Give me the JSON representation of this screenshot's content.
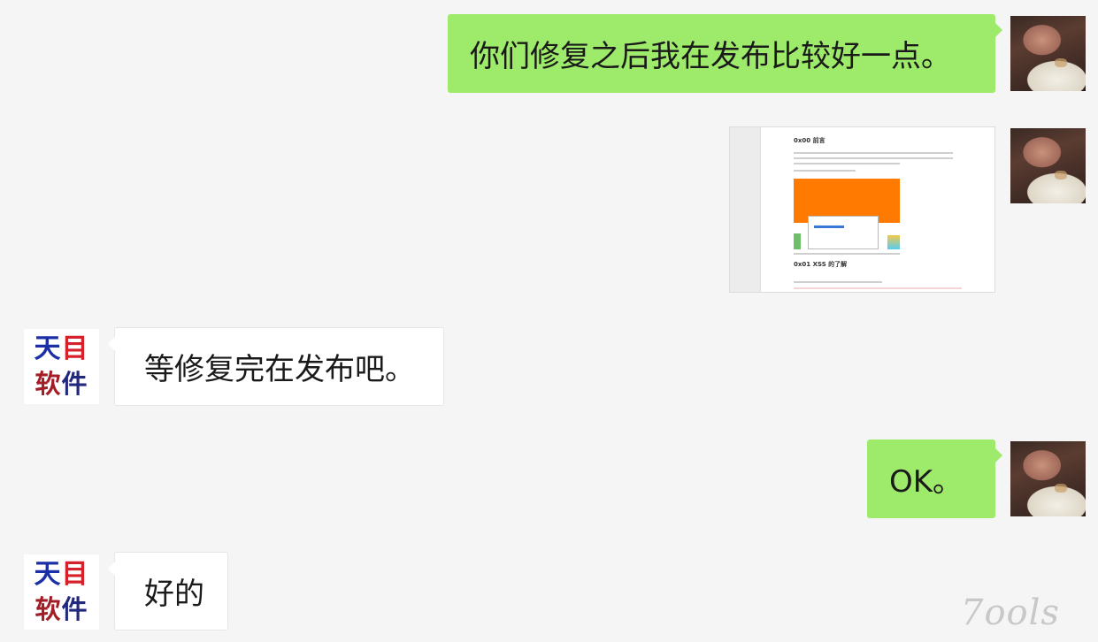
{
  "messages": [
    {
      "sender": "me",
      "type": "text",
      "text": "你们修复之后我在发布比较好一点。"
    },
    {
      "sender": "me",
      "type": "image",
      "image": {
        "doc_title": "0x00 前言",
        "doc_subtitle": "0x01 XSS 的了解"
      }
    },
    {
      "sender": "other",
      "type": "text",
      "text": "等修复完在发布吧。"
    },
    {
      "sender": "me",
      "type": "text",
      "text": "OK。"
    },
    {
      "sender": "other",
      "type": "text",
      "text": "好的"
    }
  ],
  "other_avatar": {
    "line1": [
      "天",
      "目"
    ],
    "line2": [
      "软",
      "件"
    ]
  },
  "watermark": "7ools",
  "colors": {
    "background": "#f5f5f5",
    "my_bubble": "#9eea6a",
    "other_bubble": "#ffffff",
    "logo_blue": "#1b2fa6",
    "logo_red": "#d6202a"
  }
}
